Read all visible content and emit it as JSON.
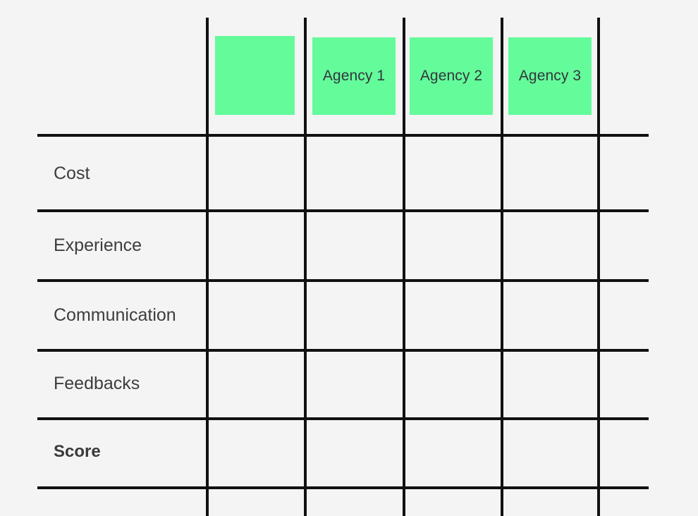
{
  "board": {
    "background_color": "#f4f4f4",
    "line_color": "#111111",
    "note_color": "#64fb9b",
    "text_color": "#3d3d3d"
  },
  "header": {
    "notes": [
      {
        "label": "",
        "name": "header-note-blank"
      },
      {
        "label": "Agency 1",
        "name": "header-note-agency-1"
      },
      {
        "label": "Agency 2",
        "name": "header-note-agency-2"
      },
      {
        "label": "Agency 3",
        "name": "header-note-agency-3"
      }
    ]
  },
  "rows": [
    {
      "label": "Cost",
      "bold": false
    },
    {
      "label": "Experience",
      "bold": false
    },
    {
      "label": "Communication",
      "bold": false
    },
    {
      "label": "Feedbacks",
      "bold": false
    },
    {
      "label": "Score",
      "bold": true
    }
  ],
  "table": {
    "columns": [
      "",
      "Agency 1",
      "Agency 2",
      "Agency 3"
    ],
    "row_headers": [
      "Cost",
      "Experience",
      "Communication",
      "Feedbacks",
      "Score"
    ],
    "cells": [
      [
        "",
        "",
        "",
        ""
      ],
      [
        "",
        "",
        "",
        ""
      ],
      [
        "",
        "",
        "",
        ""
      ],
      [
        "",
        "",
        "",
        ""
      ],
      [
        "",
        "",
        "",
        ""
      ]
    ]
  }
}
